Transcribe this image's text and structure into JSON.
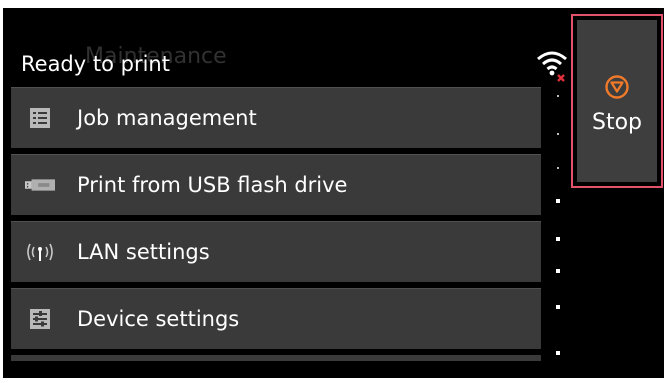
{
  "header": {
    "title": "Ready to print",
    "background_title": "Maintenance"
  },
  "menu": {
    "items": [
      {
        "label": "Job management",
        "icon": "job-management-icon"
      },
      {
        "label": "Print from USB flash drive",
        "icon": "usb-drive-icon"
      },
      {
        "label": "LAN settings",
        "icon": "antenna-icon"
      },
      {
        "label": "Device settings",
        "icon": "device-settings-icon"
      }
    ]
  },
  "status": {
    "wifi_icon": "wifi-disconnected-icon"
  },
  "stop_button": {
    "label": "Stop",
    "icon": "stop-icon",
    "accent_color": "#e0536a",
    "icon_color": "#f07a2a"
  },
  "colors": {
    "screen_bg": "#000000",
    "item_bg": "#3a3a3a",
    "text": "#ffffff"
  }
}
